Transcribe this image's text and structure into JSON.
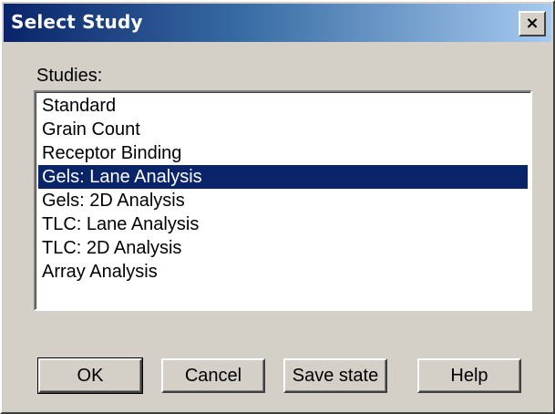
{
  "window": {
    "title": "Select Study",
    "close_glyph": "×",
    "titlebar_gradient": [
      "#0a246a",
      "#a6caf0"
    ]
  },
  "studies": {
    "label": "Studies:",
    "items": [
      "Standard",
      "Grain Count",
      "Receptor Binding",
      "Gels: Lane Analysis",
      "Gels: 2D Analysis",
      "TLC: Lane Analysis",
      "TLC: 2D Analysis",
      "Array Analysis"
    ],
    "selected": "Gels: Lane Analysis",
    "selection_color": "#0a246a"
  },
  "buttons": {
    "ok": "OK",
    "cancel": "Cancel",
    "save_state": "Save state",
    "help": "Help"
  }
}
